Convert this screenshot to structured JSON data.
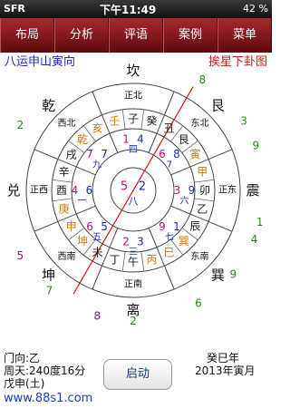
{
  "statusbar": {
    "carrier": "SFR",
    "wifi": "wifi-icon",
    "time": "下午11:49",
    "battery": "42 %",
    "watermark": "www.88s1.com"
  },
  "nav": [
    "布局",
    "分析",
    "评语",
    "案例",
    "菜单"
  ],
  "chart": {
    "title": "八运申山寅向",
    "subtitle": "挨星下卦图",
    "directions": [
      "东北",
      "正东",
      "东南",
      "正南",
      "西南",
      "正西",
      "西北",
      "正北"
    ],
    "trigrams": [
      "艮",
      "震",
      "巽",
      "离",
      "坤",
      "兑",
      "乾",
      "坎"
    ],
    "outer_numbers": [
      "5",
      "8",
      "3",
      "9",
      "1",
      "4",
      "9",
      "6",
      "2",
      "8",
      "7",
      "5",
      "6",
      "2",
      "1"
    ],
    "mountains": [
      "寅",
      "甲",
      "卯",
      "乙",
      "辰",
      "巽",
      "巳",
      "丙",
      "午",
      "丁",
      "未",
      "坤",
      "申",
      "庚",
      "酉",
      "辛",
      "戌",
      "乾",
      "亥",
      "壬",
      "子",
      "癸",
      "丑",
      "艮"
    ],
    "palaces": [
      {
        "m": "6",
        "w": "8",
        "p": "7"
      },
      {
        "m": "3",
        "w": "9",
        "p": "六"
      },
      {
        "m": "9",
        "w": "1",
        "p": "七"
      },
      {
        "m": "2",
        "w": "3",
        "p": "三"
      },
      {
        "m": "6",
        "w": "5",
        "p": "五"
      },
      {
        "m": "4",
        "w": "6",
        "p": "一"
      },
      {
        "m": "7",
        "w": "7",
        "p": "九"
      },
      {
        "m": "1",
        "w": "4",
        "p": "四"
      }
    ],
    "center": {
      "mountain": "5",
      "water": "2",
      "period": "八"
    }
  },
  "info": {
    "door": "门向:乙",
    "degree": "周天:240度16分",
    "direction": "戊申(土)",
    "year": "癸巳年",
    "month": "2013年寅月",
    "start_label": "启动",
    "site": "www.88s1.com"
  }
}
